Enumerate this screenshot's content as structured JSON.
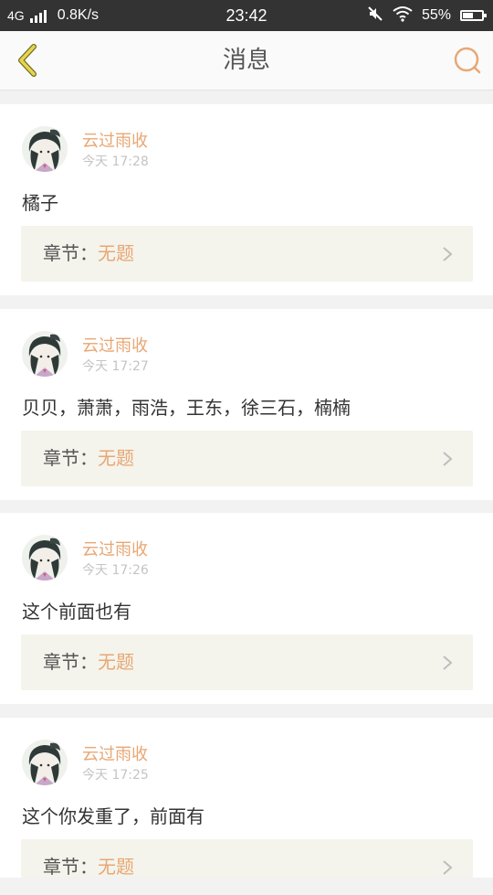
{
  "status_bar": {
    "network": "4G",
    "speed": "0.8K/s",
    "time": "23:42",
    "battery": "55%",
    "battery_level": 0.55
  },
  "header": {
    "title": "消息",
    "back_icon": "chevron-left-icon",
    "search_icon": "search-icon",
    "accent_color": "#e8a774"
  },
  "messages": [
    {
      "username": "云过雨收",
      "time": "今天 17:28",
      "content": "橘子",
      "chapter_label": "章节：",
      "chapter_title": "无题"
    },
    {
      "username": "云过雨收",
      "time": "今天 17:27",
      "content": "贝贝，萧萧，雨浩，王东，徐三石，楠楠",
      "chapter_label": "章节：",
      "chapter_title": "无题"
    },
    {
      "username": "云过雨收",
      "time": "今天 17:26",
      "content": "这个前面也有",
      "chapter_label": "章节：",
      "chapter_title": "无题"
    },
    {
      "username": "云过雨收",
      "time": "今天 17:25",
      "content": "这个你发重了，前面有",
      "chapter_label": "章节：",
      "chapter_title": "无题"
    }
  ]
}
